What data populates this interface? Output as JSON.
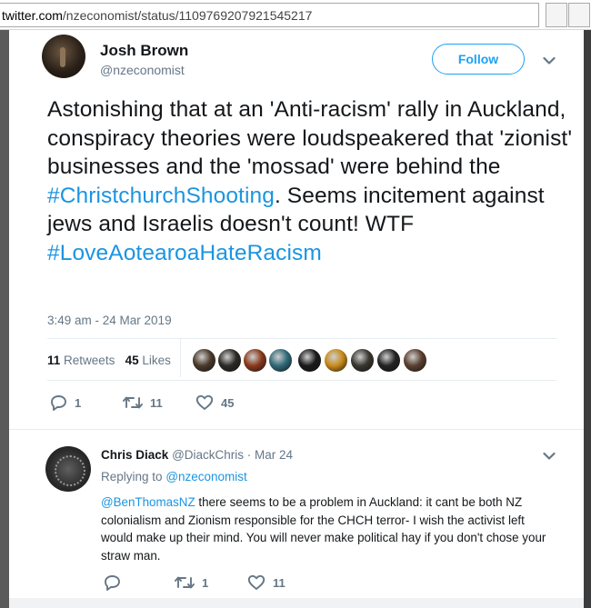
{
  "browser": {
    "url_domain": "twitter.com",
    "url_path": "/nzeconomist/status/1109769207921545217"
  },
  "tweet": {
    "display_name": "Josh Brown",
    "handle": "@nzeconomist",
    "follow_label": "Follow",
    "text_part1": "Astonishing that at an 'Anti-racism' rally in Auckland, conspiracy theories were loudspeakered that 'zionist' businesses and the 'mossad' were behind the ",
    "hashtag1": "#ChristchurchShooting",
    "text_part2": ".  Seems incitement against jews and Israelis doesn't count! WTF ",
    "hashtag2": "#LoveAotearoaHateRacism",
    "timestamp": "3:49 am - 24 Mar 2019",
    "retweets_count": "11",
    "retweets_label": "Retweets",
    "likes_count": "45",
    "likes_label": "Likes",
    "reply_count": "1",
    "retweet_action_count": "11",
    "like_action_count": "45"
  },
  "likers": [
    {
      "icon": "liker-avatar",
      "color": "#4a3a2a"
    },
    {
      "icon": "liker-avatar",
      "color": "#2d2a25"
    },
    {
      "icon": "liker-avatar",
      "color": "#8a3a1c"
    },
    {
      "icon": "liker-avatar",
      "color": "#2f6a78"
    },
    {
      "icon": "liker-avatar",
      "color": "#1a1a1a"
    },
    {
      "icon": "liker-avatar",
      "color": "#c98a1a"
    },
    {
      "icon": "liker-avatar",
      "color": "#3a3630"
    },
    {
      "icon": "liker-avatar",
      "color": "#222222"
    },
    {
      "icon": "liker-avatar",
      "color": "#5a4030"
    }
  ],
  "reply": {
    "display_name": "Chris Diack",
    "handle_date": "@DiackChris · Mar 24",
    "replying_to_label": "Replying to",
    "replying_to_handle": "@nzeconomist",
    "mention": "@BenThomasNZ",
    "text": "  there seems to be a problem in Auckland: it cant be both NZ colonialism and Zionism responsible for the CHCH terror- I wish the activist left would make up their mind.  You will never make political hay if you don't chose your straw man.",
    "reply_count": "",
    "retweet_count": "1",
    "like_count": "11"
  },
  "colors": {
    "accent": "#1da1f2",
    "link": "#1b95e0",
    "muted": "#657786",
    "text": "#14171a"
  }
}
